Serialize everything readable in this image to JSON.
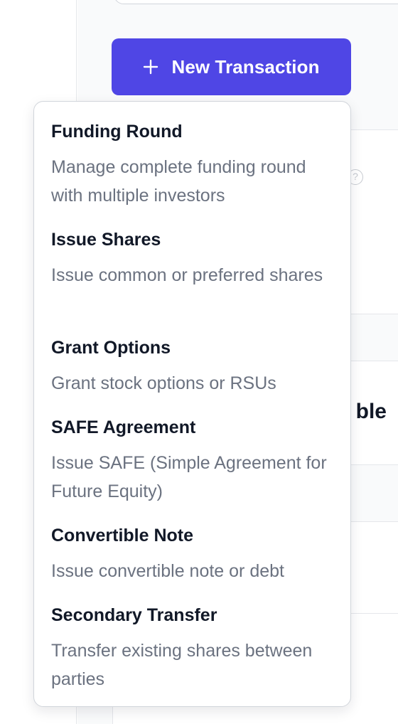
{
  "header": {
    "new_transaction_label": "New Transaction"
  },
  "background": {
    "heading_fragment": "ble",
    "help_glyph": "?"
  },
  "menu": {
    "items": [
      {
        "title": "Funding Round",
        "description": "Manage complete funding round with multiple investors"
      },
      {
        "title": "Issue Shares",
        "description": "Issue common or preferred shares"
      },
      {
        "title": "Grant Options",
        "description": "Grant stock options or RSUs"
      },
      {
        "title": "SAFE Agreement",
        "description": "Issue SAFE (Simple Agreement for Future Equity)"
      },
      {
        "title": "Convertible Note",
        "description": "Issue convertible note or debt"
      },
      {
        "title": "Secondary Transfer",
        "description": "Transfer existing shares between parties"
      }
    ]
  },
  "icons": {
    "plus": "plus-icon",
    "help": "question-circle-icon"
  },
  "colors": {
    "accent": "#4f46e5",
    "title_text": "#111827",
    "description_text": "#6b7280",
    "menu_border": "#d1d5db"
  }
}
